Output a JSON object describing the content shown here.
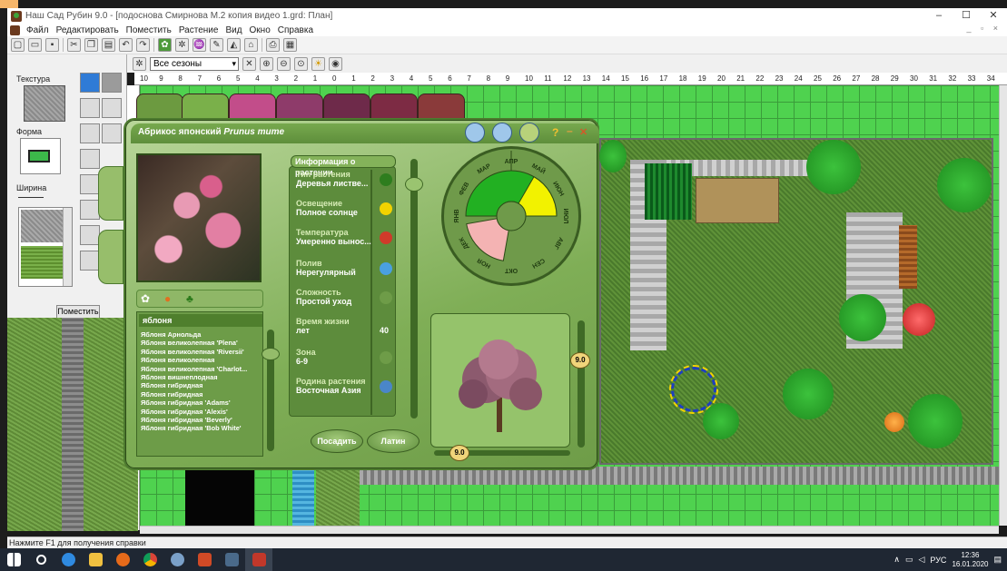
{
  "window": {
    "title": "Наш Сад Рубин 9.0 - [подоснова Смирнова М.2 копия видео 1.grd: План]",
    "controls": [
      "–",
      "☐",
      "✕"
    ]
  },
  "menu": [
    "Файл",
    "Редактировать",
    "Поместить",
    "Растение",
    "Вид",
    "Окно",
    "Справка"
  ],
  "toolbar2": {
    "season_value": "Все сезоны"
  },
  "left_panel": {
    "texture_label": "Текстура",
    "shape_label": "Форма",
    "width_label": "Ширина",
    "place_button": "Поместить"
  },
  "ruler": {
    "h_ticks": [
      "10",
      "9",
      "8",
      "7",
      "6",
      "5",
      "4",
      "3",
      "2",
      "1",
      "0",
      "1",
      "2",
      "3",
      "4",
      "5",
      "6",
      "7",
      "8",
      "9",
      "10",
      "11",
      "12",
      "13",
      "14",
      "15",
      "16",
      "17",
      "18",
      "19",
      "20",
      "21",
      "22",
      "23",
      "24",
      "25",
      "26",
      "27",
      "28",
      "29",
      "30",
      "31",
      "32",
      "33",
      "34"
    ],
    "v_ticks": [
      "14",
      "15",
      "16"
    ]
  },
  "encyclopedia": {
    "common_name": "Абрикос японский",
    "latin_name": "Prunus mume",
    "info_title": "Информация о растении",
    "info": [
      {
        "key": "Тип растения",
        "value": "Деревья листве..."
      },
      {
        "key": "Освещение",
        "value": "Полное солнце"
      },
      {
        "key": "Температура",
        "value": "Умеренно вынос..."
      },
      {
        "key": "Полив",
        "value": "Нерегулярный"
      },
      {
        "key": "Сложность",
        "value": "Простой уход"
      },
      {
        "key": "Время жизни",
        "value": "лет",
        "extra": "40"
      },
      {
        "key": "Зона",
        "value": "6-9"
      },
      {
        "key": "Родина растения",
        "value": "Восточная Азия"
      }
    ],
    "list_title": "яблоня",
    "plants": [
      "Яблоня Арнольда",
      "Яблоня великолепная 'Plena'",
      "Яблоня великолепная 'Riversii'",
      "Яблоня великолепная",
      "Яблоня великолепная 'Charlot...",
      "Яблоня вишнеплодная",
      "Яблоня гибридная",
      "Яблоня гибридная",
      "Яблоня гибридная 'Adams'",
      "Яблоня гибридная 'Alexis'",
      "Яблоня гибридная 'Beverly'",
      "Яблоня гибридная 'Bob White'"
    ],
    "calendar_months": [
      "МАЙ",
      "ИЮН",
      "ИЮЛ",
      "АВГ",
      "СЕН",
      "ОКТ",
      "НОЯ",
      "ДЕК",
      "ЯНВ",
      "ФЕВ",
      "МАР",
      "АПР"
    ],
    "size_value": "9.0",
    "width_value": "9.0",
    "plant_button": "Посадить",
    "latin_button": "Латин"
  },
  "status": "Нажмите F1 для получения справки",
  "tray": {
    "lang": "РУС",
    "time": "12:36",
    "date": "16.01.2020"
  },
  "colors": {
    "grass": "#4fd24f",
    "panel": "#7fae56",
    "selection": "#f2d200"
  }
}
